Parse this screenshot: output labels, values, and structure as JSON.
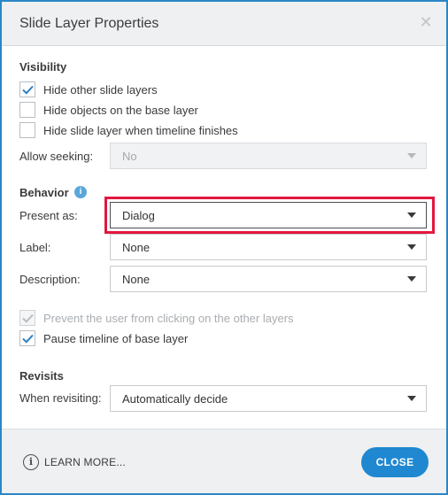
{
  "window": {
    "title": "Slide Layer Properties"
  },
  "visibility": {
    "heading": "Visibility",
    "options": [
      {
        "label": "Hide other slide layers",
        "checked": true
      },
      {
        "label": "Hide objects on the base layer",
        "checked": false
      },
      {
        "label": "Hide slide layer when timeline finishes",
        "checked": false
      }
    ],
    "allow_seeking": {
      "label": "Allow seeking:",
      "value": "No",
      "disabled": true
    }
  },
  "behavior": {
    "heading": "Behavior",
    "present_as": {
      "label": "Present as:",
      "value": "Dialog"
    },
    "label_field": {
      "label": "Label:",
      "value": "None"
    },
    "description": {
      "label": "Description:",
      "value": "None"
    },
    "options": [
      {
        "label": "Prevent the user from clicking on the other layers",
        "checked": true,
        "disabled": true
      },
      {
        "label": "Pause timeline of base layer",
        "checked": true,
        "disabled": false
      }
    ]
  },
  "revisits": {
    "heading": "Revisits",
    "when_revisiting": {
      "label": "When revisiting:",
      "value": "Automatically decide"
    }
  },
  "footer": {
    "learn_more": "LEARN MORE...",
    "close": "CLOSE"
  },
  "colors": {
    "accent": "#1f88d1",
    "highlight": "#e3173e",
    "checkmark": "#2b7fc1"
  }
}
